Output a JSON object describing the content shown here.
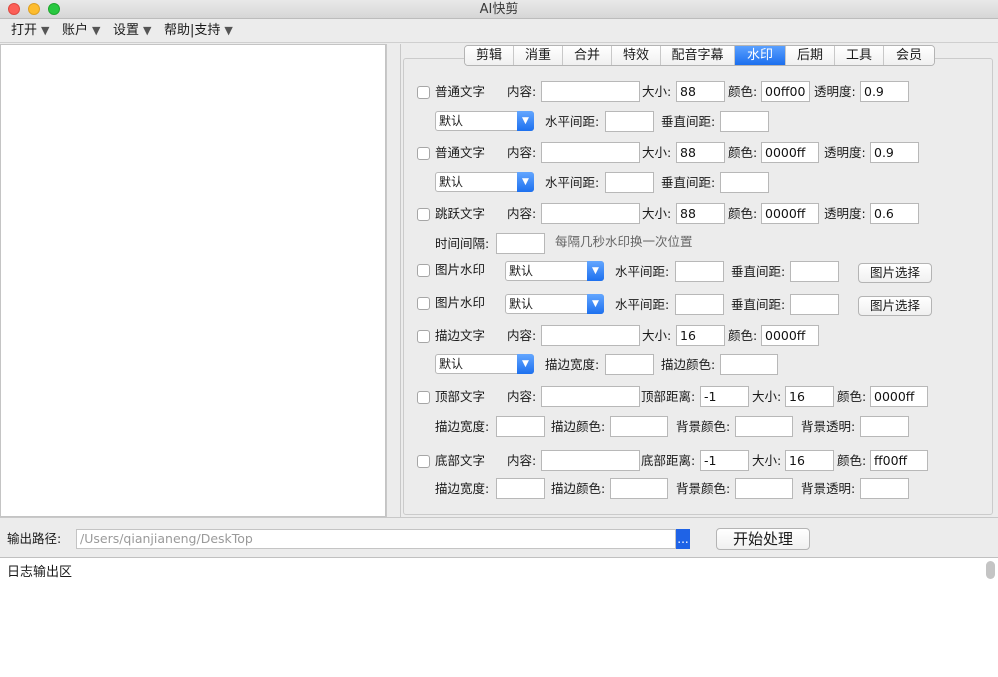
{
  "window": {
    "title": "AI快剪"
  },
  "menubar": [
    {
      "label": "打开",
      "arrow": "▼"
    },
    {
      "label": "账户",
      "arrow": "▼"
    },
    {
      "label": "设置",
      "arrow": "▼"
    },
    {
      "label": "帮助|支持",
      "arrow": "▼"
    }
  ],
  "tabs": [
    "剪辑",
    "消重",
    "合并",
    "特效",
    "配音字幕",
    "水印",
    "后期",
    "工具",
    "会员"
  ],
  "active_tab": "水印",
  "labels": {
    "content": "内容:",
    "size": "大小:",
    "color": "颜色:",
    "opacity": "透明度:",
    "h_spacing": "水平间距:",
    "v_spacing": "垂直间距:",
    "interval": "时间间隔:",
    "interval_hint": "每隔几秒水印换一次位置",
    "stroke_width": "描边宽度:",
    "stroke_color": "描边颜色:",
    "top_distance": "顶部距离:",
    "bottom_distance": "底部距离:",
    "bg_color": "背景颜色:",
    "bg_opacity": "背景透明:"
  },
  "rows": {
    "normal_text_1": {
      "label": "普通文字",
      "content": "",
      "size": "88",
      "color": "00ff00",
      "opacity": "0.9",
      "select": "默认",
      "h_spacing": "",
      "v_spacing": ""
    },
    "normal_text_2": {
      "label": "普通文字",
      "content": "",
      "size": "88",
      "color": "0000ff",
      "opacity": "0.9",
      "select": "默认",
      "h_spacing": "",
      "v_spacing": ""
    },
    "jump_text": {
      "label": "跳跃文字",
      "content": "",
      "size": "88",
      "color": "0000ff",
      "opacity": "0.6",
      "interval": ""
    },
    "image_wm_1": {
      "label": "图片水印",
      "select": "默认",
      "h_spacing": "",
      "v_spacing": "",
      "button": "图片选择"
    },
    "image_wm_2": {
      "label": "图片水印",
      "select": "默认",
      "h_spacing": "",
      "v_spacing": "",
      "button": "图片选择"
    },
    "stroke_text": {
      "label": "描边文字",
      "content": "",
      "size": "16",
      "color": "0000ff",
      "select": "默认",
      "stroke_width": "",
      "stroke_color": ""
    },
    "top_text": {
      "label": "顶部文字",
      "content": "",
      "distance": "-1",
      "size": "16",
      "color": "0000ff",
      "stroke_width": "",
      "stroke_color": "",
      "bg_color": "",
      "bg_opacity": ""
    },
    "bottom_text": {
      "label": "底部文字",
      "content": "",
      "distance": "-1",
      "size": "16",
      "color": "ff00ff",
      "stroke_width": "",
      "stroke_color": "",
      "bg_color": "",
      "bg_opacity": ""
    }
  },
  "output": {
    "label": "输出路径:",
    "path": "/Users/qianjianeng/DeskTop",
    "browse": "...",
    "start": "开始处理"
  },
  "log": {
    "text": "日志输出区"
  }
}
